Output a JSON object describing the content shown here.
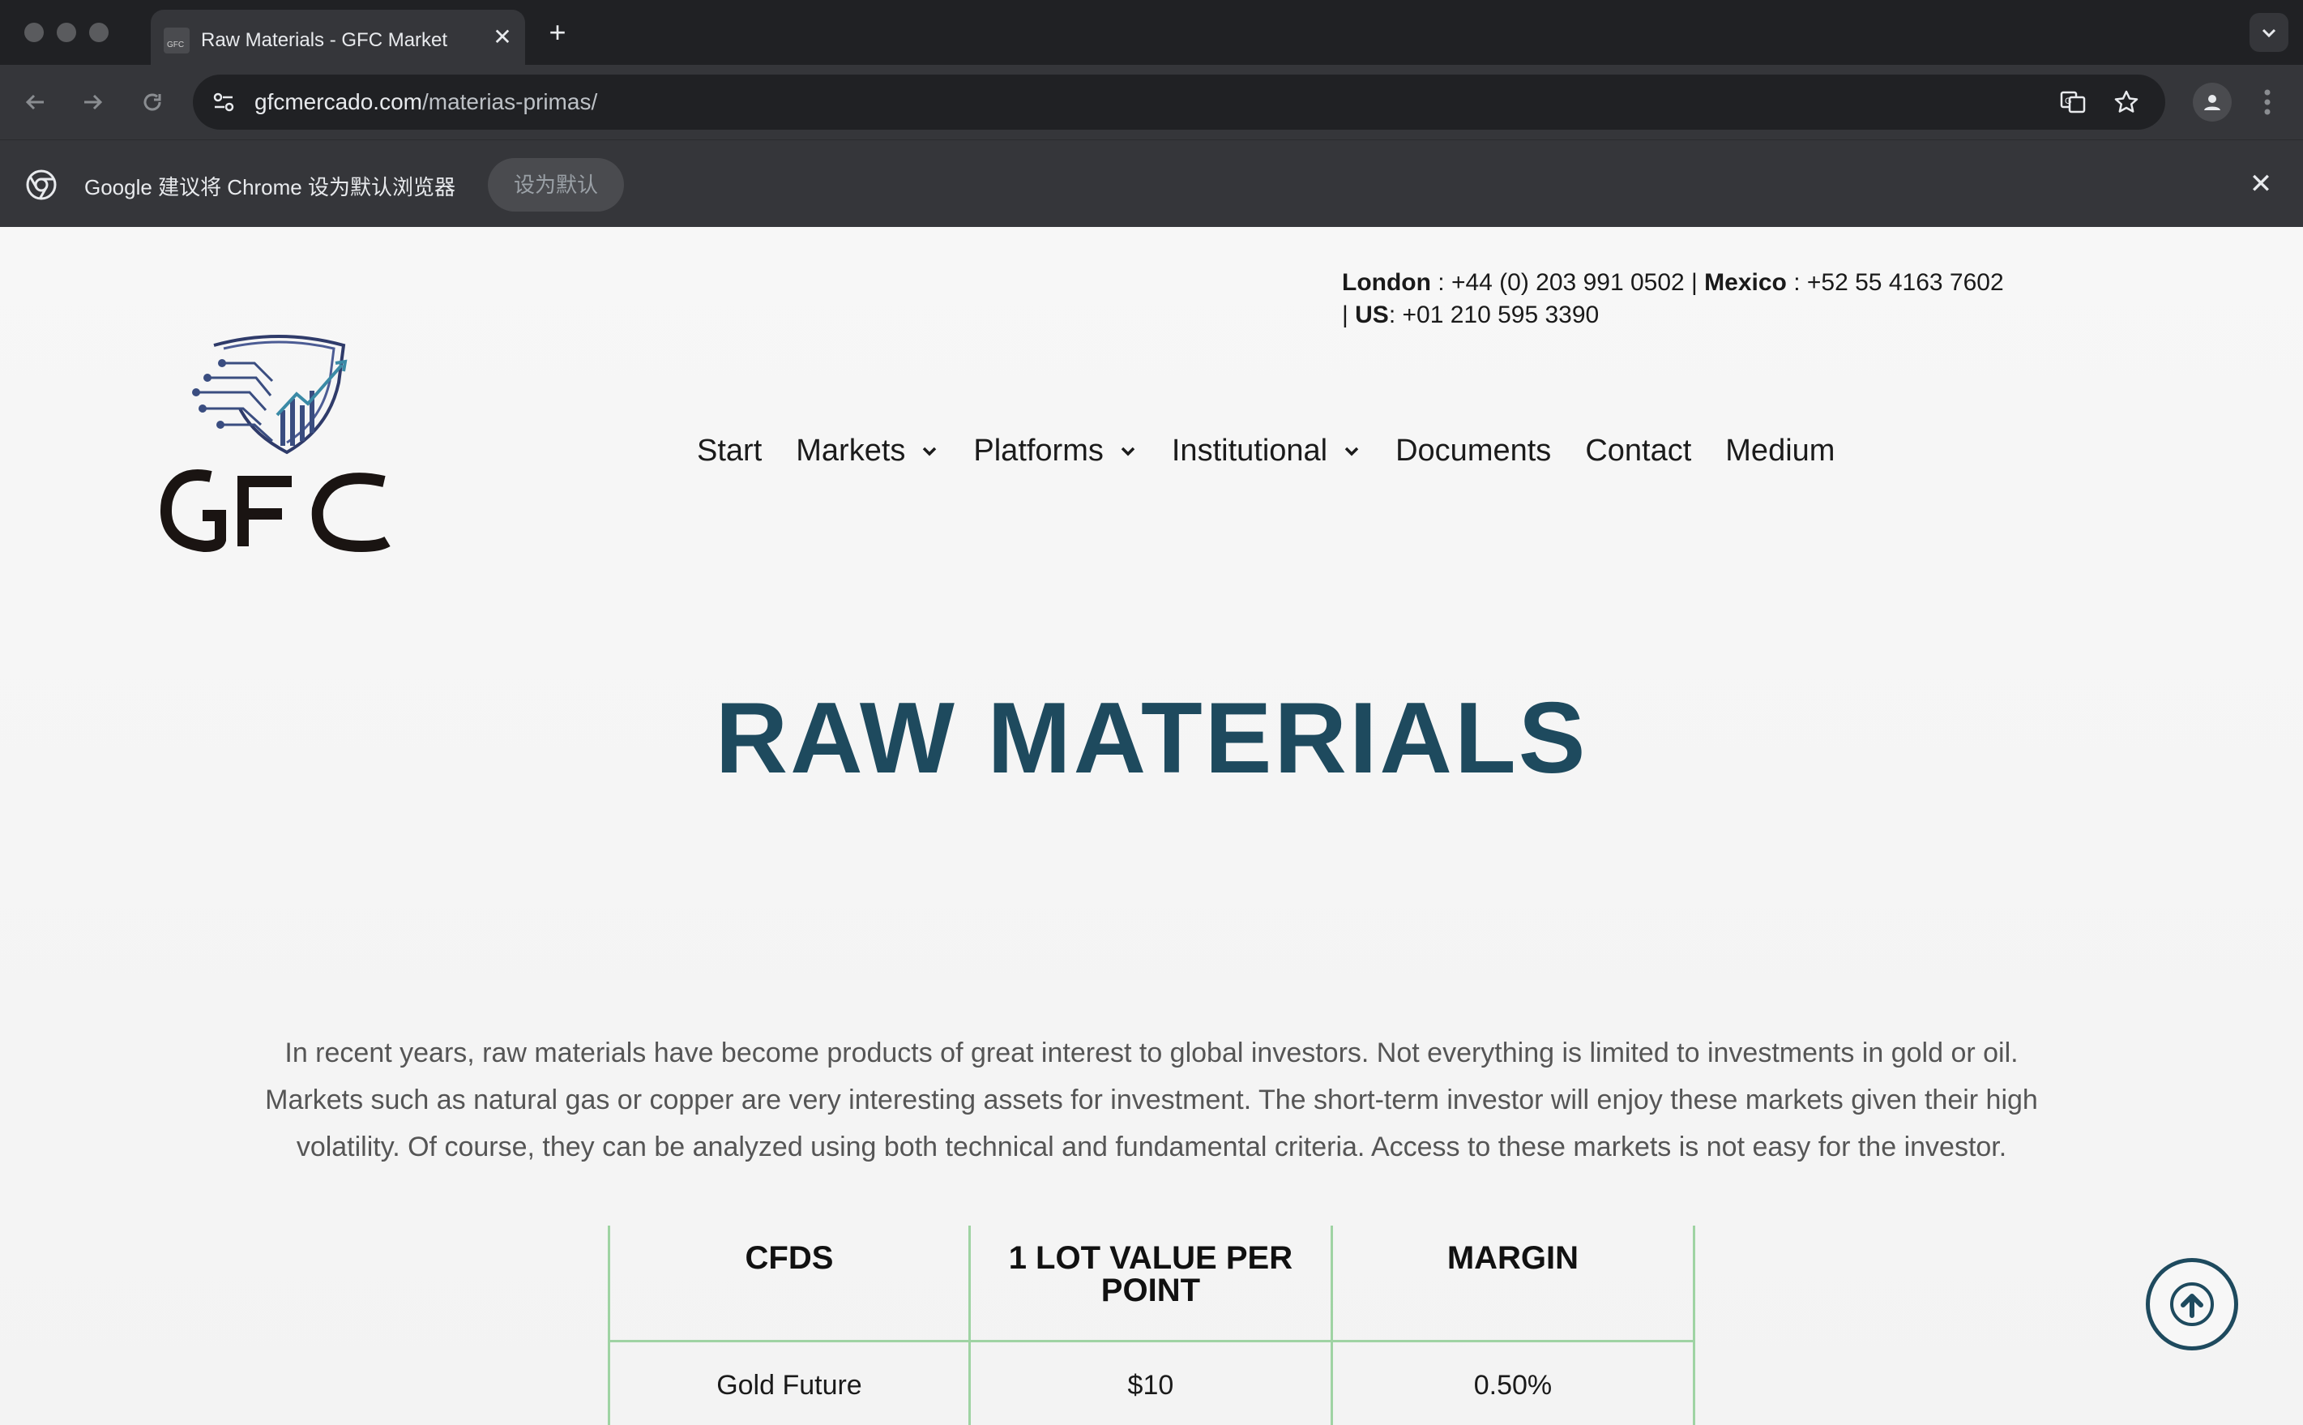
{
  "browser": {
    "tab_title": "Raw Materials - GFC Market",
    "tab_close": "✕",
    "new_tab": "+",
    "url_host": "gfcmercado.com",
    "url_path": "/materias-primas/",
    "infobar_text": "Google 建议将 Chrome 设为默认浏览器",
    "infobar_button": "设为默认",
    "infobar_close": "✕"
  },
  "contact": {
    "london_label": "London",
    "london_phone": " : +44 (0) 203 991 0502 | ",
    "mexico_label": "Mexico",
    "mexico_phone": " : +52 55 4163 7602",
    "us_prefix": "| ",
    "us_label": "US",
    "us_phone": ": +01 210 595 3390"
  },
  "nav": {
    "start": "Start",
    "markets": "Markets",
    "platforms": "Platforms",
    "institutional": "Institutional",
    "documents": "Documents",
    "contact": "Contact",
    "medium": "Medium"
  },
  "hero": {
    "title": "RAW MATERIALS"
  },
  "intro": {
    "text": "In recent years, raw materials have become products of great interest to global investors. Not everything is limited to investments in gold or oil. Markets such as natural gas or copper are very interesting assets for investment. The short-term investor will enjoy these markets given their high volatility. Of course, they can be analyzed using both technical and fundamental criteria. Access to these markets is not easy for the investor."
  },
  "table": {
    "headers": [
      "CFDS",
      "1 LOT VALUE PER POINT",
      "MARGIN"
    ],
    "rows": [
      [
        "Gold Future",
        "$10",
        "0.50%"
      ]
    ]
  },
  "icons": {
    "nav_chevron": "chevron-down-icon",
    "scroll_top": "arrow-up-circle-icon"
  },
  "colors": {
    "brand_navy": "#1e4a5e",
    "table_border": "#9fd3a3"
  }
}
